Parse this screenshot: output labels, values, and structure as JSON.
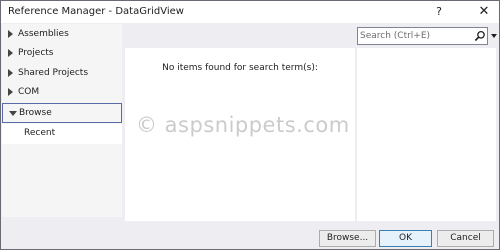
{
  "window": {
    "title": "Reference Manager - DataGridView",
    "help_label": "?",
    "close_label": "✕"
  },
  "sidebar": {
    "items": [
      {
        "label": "Assemblies",
        "expanded": false
      },
      {
        "label": "Projects",
        "expanded": false
      },
      {
        "label": "Shared Projects",
        "expanded": false
      },
      {
        "label": "COM",
        "expanded": false
      },
      {
        "label": "Browse",
        "expanded": true,
        "selected": true
      }
    ],
    "sub_items": [
      {
        "label": "Recent"
      }
    ]
  },
  "search": {
    "placeholder": "Search (Ctrl+E)",
    "value": "",
    "icon": "search-icon"
  },
  "main": {
    "empty_message": "No items found for search term(s):"
  },
  "watermark": {
    "text": "© aspsnippets.com"
  },
  "footer": {
    "browse_label": "Browse...",
    "ok_label": "OK",
    "cancel_label": "Cancel"
  },
  "colors": {
    "dialog_background": "#eeeef2",
    "selected_border": "#5b6ba8",
    "default_button_border": "#3c7fb1"
  }
}
